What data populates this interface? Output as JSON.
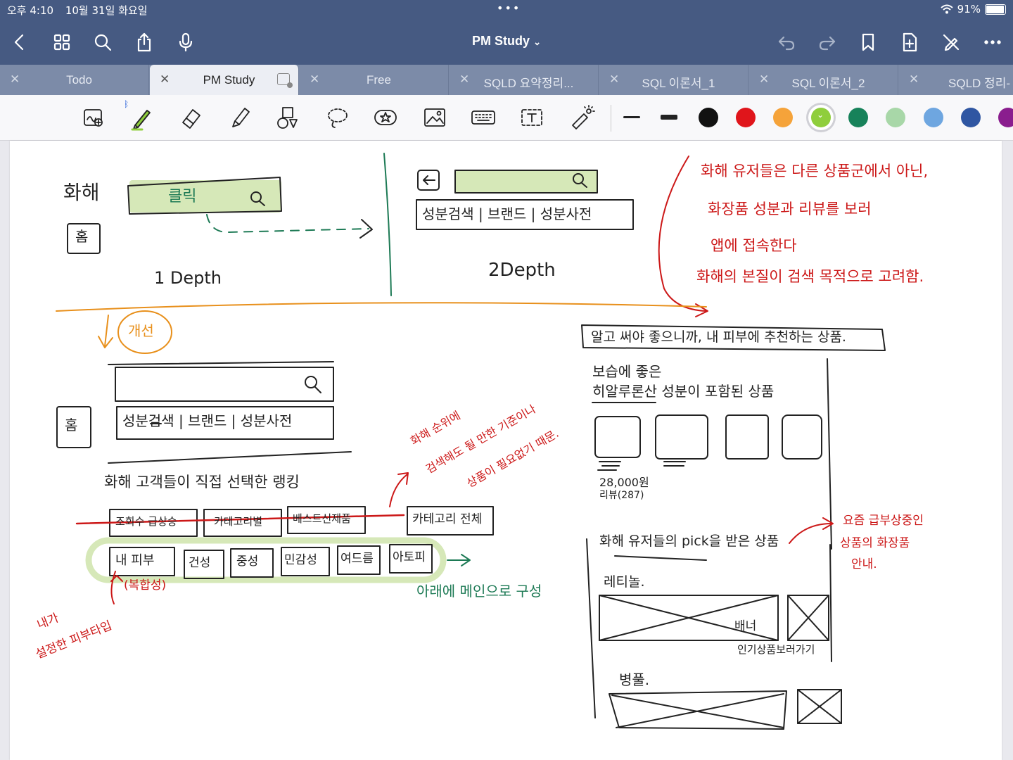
{
  "status_bar": {
    "time": "오후 4:10",
    "date": "10월 31일 화요일",
    "battery": "91%",
    "battery_level": 0.91
  },
  "nav": {
    "title": "PM Study"
  },
  "tabs": [
    {
      "label": "Todo",
      "active": false
    },
    {
      "label": "PM Study",
      "active": true
    },
    {
      "label": "Free",
      "active": false
    },
    {
      "label": "SQLD 요약정리...",
      "active": false
    },
    {
      "label": "SQL 이론서_1",
      "active": false
    },
    {
      "label": "SQL 이론서_2",
      "active": false
    },
    {
      "label": "SQLD 정리-",
      "active": false
    }
  ],
  "toolbar": {
    "tools": [
      "zoom-window-icon",
      "pen-icon",
      "eraser-icon",
      "highlighter-icon",
      "shapes-icon",
      "lasso-icon",
      "sticker-icon",
      "image-icon",
      "keyboard-icon",
      "text-icon",
      "laser-pointer-icon"
    ],
    "stroke_widths": [
      "thin",
      "thick"
    ],
    "colors": [
      "#111111",
      "#e0151b",
      "#f5a33a",
      "#8fce3c",
      "#17825a",
      "#a8d7a8",
      "#6ea6e0",
      "#2f56a2",
      "#8a1d8e"
    ],
    "selected_color": "#8fce3c"
  },
  "sketch": {
    "top_left": {
      "label": "화해",
      "home": "홈",
      "search_text": "클릭",
      "depth": "1 Depth"
    },
    "top_mid": {
      "search_row": "성분검색 | 브랜드 | 성분사전",
      "depth": "2Depth"
    },
    "top_note": [
      "화해 유저들은 다른 상품군에서 아닌,",
      "화장품 성분과 리뷰를 보러",
      "앱에 접속한다",
      "화해의 본질이 검색 목적으로 고려함."
    ],
    "improve_label": "개선",
    "bottom_left": {
      "home": "홈",
      "search_row": "성분검색 | 브랜드 | 성분사전",
      "ranking_title": "화해 고객들이 직접 선택한 랭킹",
      "strike_tabs": [
        "조회수 급상승",
        "카테고리별",
        "베스트신제품"
      ],
      "category_tab": "카테고리 전체",
      "red_note": [
        "화해 순위에",
        "검색해도 될 만한 기준이나",
        "상품이 필요없기 때문."
      ],
      "skin_tabs": [
        "내 피부",
        "건성",
        "중성",
        "민감성",
        "여드름",
        "아토피"
      ],
      "sub_label": "(복합성)",
      "green_note": "아래에 메인으로 구성",
      "red_note_left": [
        "내가",
        "설정한 피부타입"
      ]
    },
    "right_panel": {
      "header": "알고 써야 좋으니까, 내 피부에 추천하는 상품.",
      "section1_line1": "보습에 좋은",
      "section1_line2": "히알루론산 성분이 포함된 상품",
      "price": "28,000원",
      "reviews": "리뷰(287)",
      "pick_title": "화해 유저들의 pick을 받은 상품",
      "red_note": [
        "요즘 급부상중인",
        "상품의 화장품",
        "안내."
      ],
      "cat1": "레티놀.",
      "banner": "배너",
      "banner_note": "인기상품보러가기",
      "cat2": "병풀."
    }
  }
}
